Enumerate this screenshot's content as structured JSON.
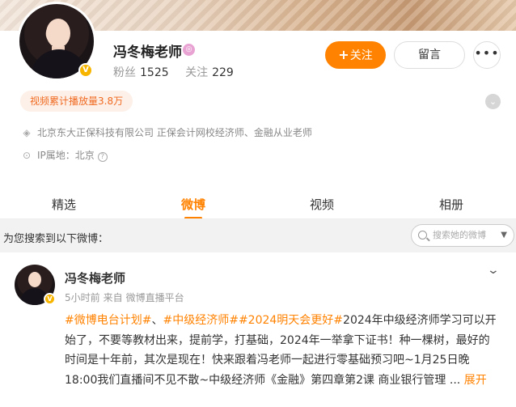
{
  "profile": {
    "name": "冯冬梅老师",
    "name_badge_icon": "pink-badge-icon",
    "verified_icon": "v-verified-icon",
    "fans_label": "粉丝",
    "fans_value": "1525",
    "following_label": "关注",
    "following_value": "229",
    "follow_button": "关注",
    "message_button": "留言",
    "more_button": "•••",
    "views_tag": "视频累计播放量3.8万",
    "verification": "北京东大正保科技有限公司 正保会计网校经济师、金融从业老师",
    "ip_location": "IP属地：北京"
  },
  "tabs": [
    {
      "label": "精选",
      "active": false
    },
    {
      "label": "微博",
      "active": true
    },
    {
      "label": "视频",
      "active": false
    },
    {
      "label": "相册",
      "active": false
    }
  ],
  "search": {
    "label": "为您搜索到以下微博：",
    "placeholder": "搜索她的微博"
  },
  "post": {
    "author": "冯冬梅老师",
    "time": "5小时前",
    "source_prefix": "来自",
    "source": "微博直播平台",
    "topics": [
      "#微博电台计划#",
      "#中级经济师#",
      "#2024明天会更好#"
    ],
    "separator": "、",
    "body": "2024年中级经济师学习可以开始了，不要等教材出来，提前学，打基础，2024年一举拿下证书！种一棵树，最好的时间是十年前，其次是现在！快来跟着冯老师一起进行零基础预习吧~1月25日晚18:00我们直播间不见不散~中级经济师《金融》第四章第2课 商业银行管理",
    "ellipsis": " ...",
    "expand_link": "展开"
  },
  "colors": {
    "accent": "#ff8200",
    "tag_bg": "#fdf0e8",
    "verified": "#f7b500"
  }
}
